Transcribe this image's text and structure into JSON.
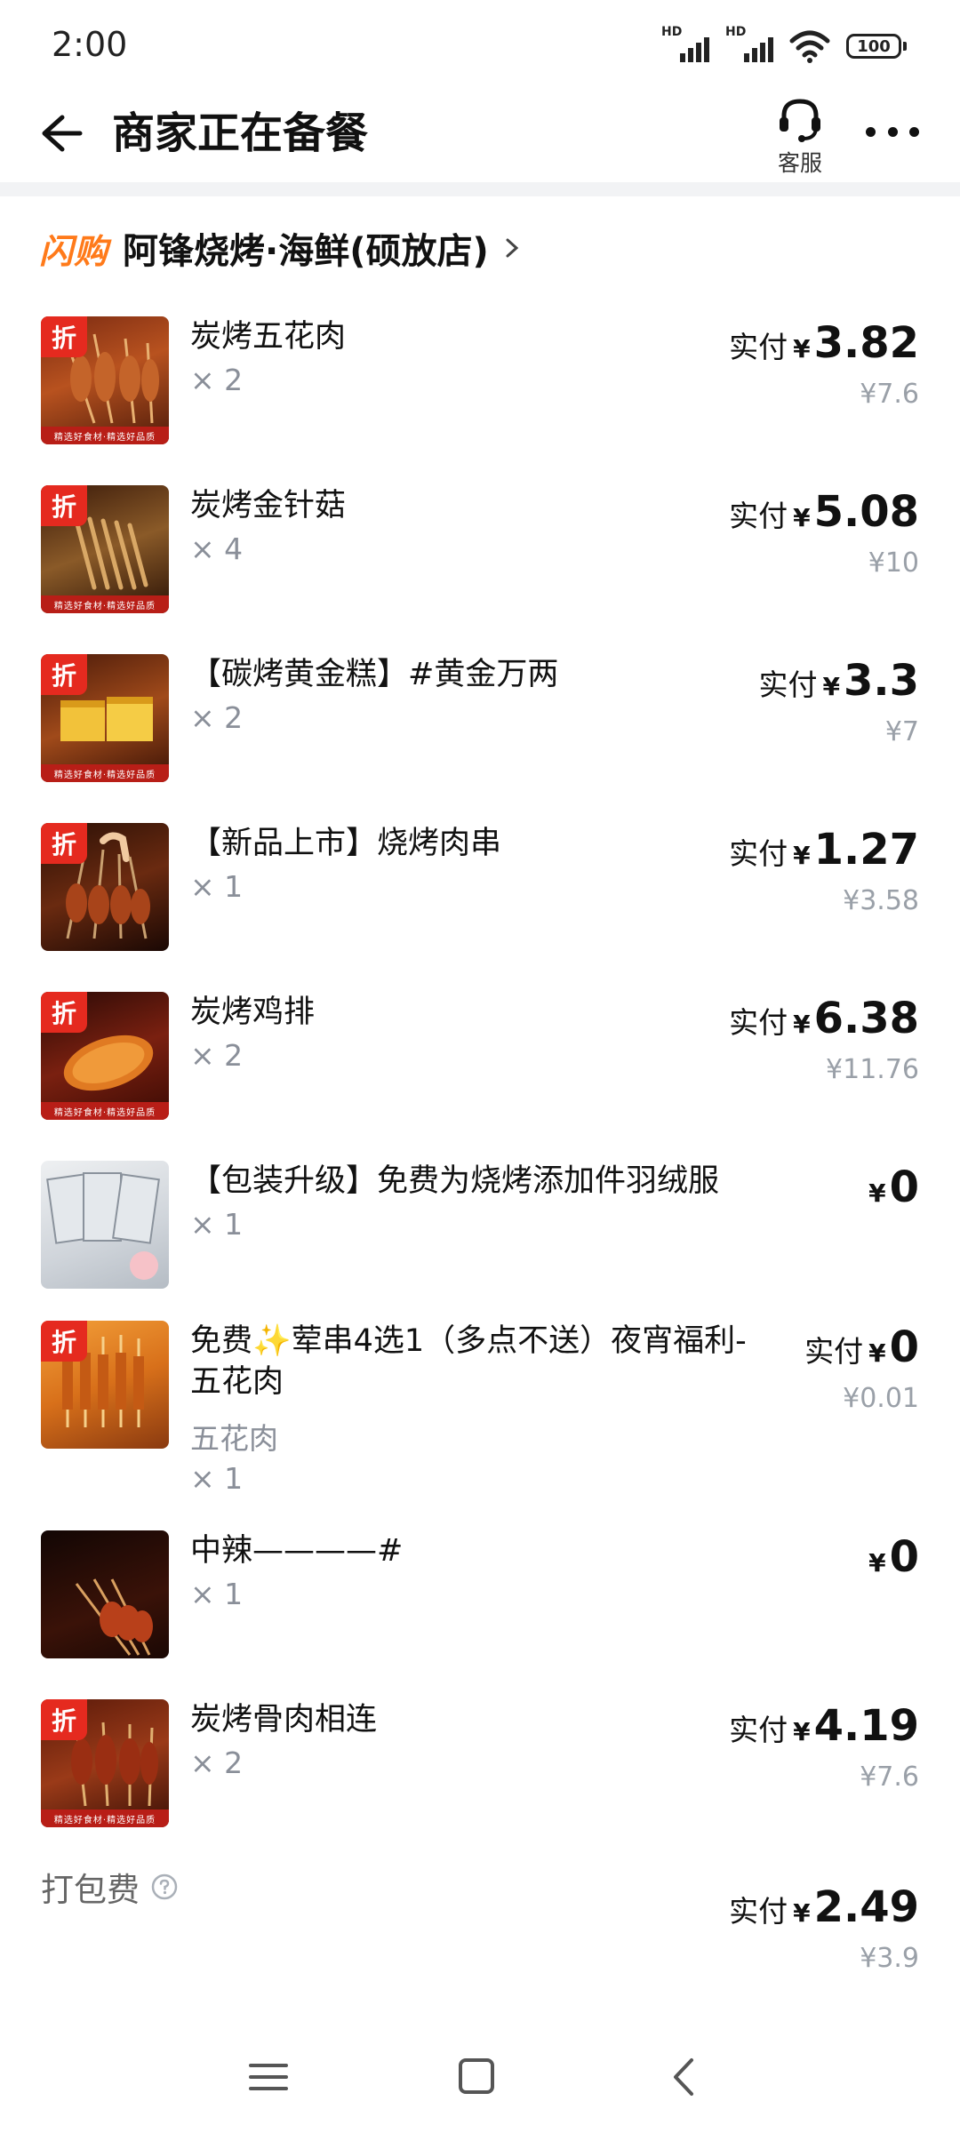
{
  "status_bar": {
    "time": "2:00",
    "signal_1_label": "HD",
    "signal_2_label": "HD",
    "battery": "100"
  },
  "nav": {
    "title": "商家正在备餐",
    "service_label": "客服"
  },
  "shop": {
    "tag": "闪购",
    "name": "阿锋烧烤·海鲜(硕放店)"
  },
  "labels": {
    "paid": "实付",
    "currency": "¥"
  },
  "thumb_strip_text": "精选好食材·精选好品质",
  "discount_badge": "折",
  "items": [
    {
      "name": "炭烤五花肉",
      "qty": "× 2",
      "price": "3.82",
      "original": "¥7.6"
    },
    {
      "name": "炭烤金针菇",
      "qty": "× 4",
      "price": "5.08",
      "original": "¥10"
    },
    {
      "name": "【碳烤黄金糕】#黄金万两",
      "qty": "× 2",
      "price": "3.3",
      "original": "¥7"
    },
    {
      "name": "【新品上市】烧烤肉串",
      "qty": "× 1",
      "price": "1.27",
      "original": "¥3.58"
    },
    {
      "name": "炭烤鸡排",
      "qty": "× 2",
      "price": "6.38",
      "original": "¥11.76"
    },
    {
      "name": "【包装升级】免费为烧烤添加件羽绒服",
      "qty": "× 1",
      "price": "0"
    },
    {
      "name": "免费✨荤串4选1（多点不送）夜宵福利-五花肉",
      "spec": "五花肉",
      "qty": "× 1",
      "price": "0",
      "original": "¥0.01"
    },
    {
      "name": "中辣————#",
      "qty": "× 1",
      "price": "0"
    },
    {
      "name": "炭烤骨肉相连",
      "qty": "× 2",
      "price": "4.19",
      "original": "¥7.6"
    }
  ],
  "packing_fee": {
    "label": "打包费",
    "price": "2.49",
    "original": "¥3.9"
  },
  "colors": {
    "accent_orange": "#ff7a1a",
    "badge_red": "#e52a1f",
    "muted_gray": "#9aa0a8"
  }
}
